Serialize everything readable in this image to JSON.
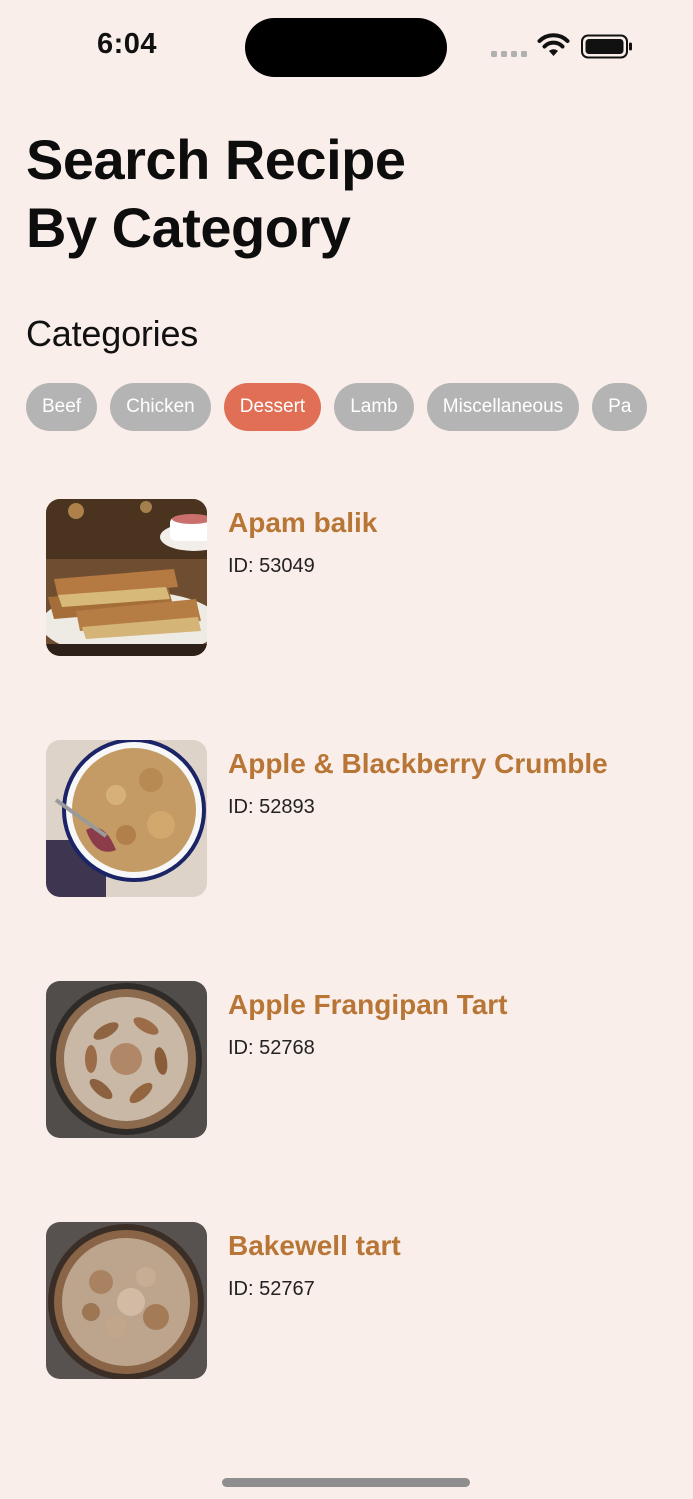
{
  "status_bar": {
    "time": "6:04",
    "icons": [
      "signal-icon",
      "wifi-icon",
      "battery-icon"
    ]
  },
  "header": {
    "title_line1": "Search Recipe",
    "title_line2": "By Category"
  },
  "categories": {
    "label": "Categories",
    "selected": "Dessert",
    "items": [
      "Beef",
      "Chicken",
      "Dessert",
      "Lamb",
      "Miscellaneous",
      "Pa"
    ]
  },
  "recipes": [
    {
      "name": "Apam balik",
      "id": "ID: 53049",
      "image": "apam-balik-photo"
    },
    {
      "name": "Apple & Blackberry Crumble",
      "id": "ID: 52893",
      "image": "crumble-photo"
    },
    {
      "name": "Apple Frangipan Tart",
      "id": "ID: 52768",
      "image": "frangipan-tart-photo"
    },
    {
      "name": "Bakewell tart",
      "id": "ID: 52767",
      "image": "bakewell-tart-photo"
    }
  ],
  "colors": {
    "background": "#faeeea",
    "chip_default": "#b4b4b4",
    "chip_selected": "#e06f55",
    "recipe_title": "#b87636"
  }
}
